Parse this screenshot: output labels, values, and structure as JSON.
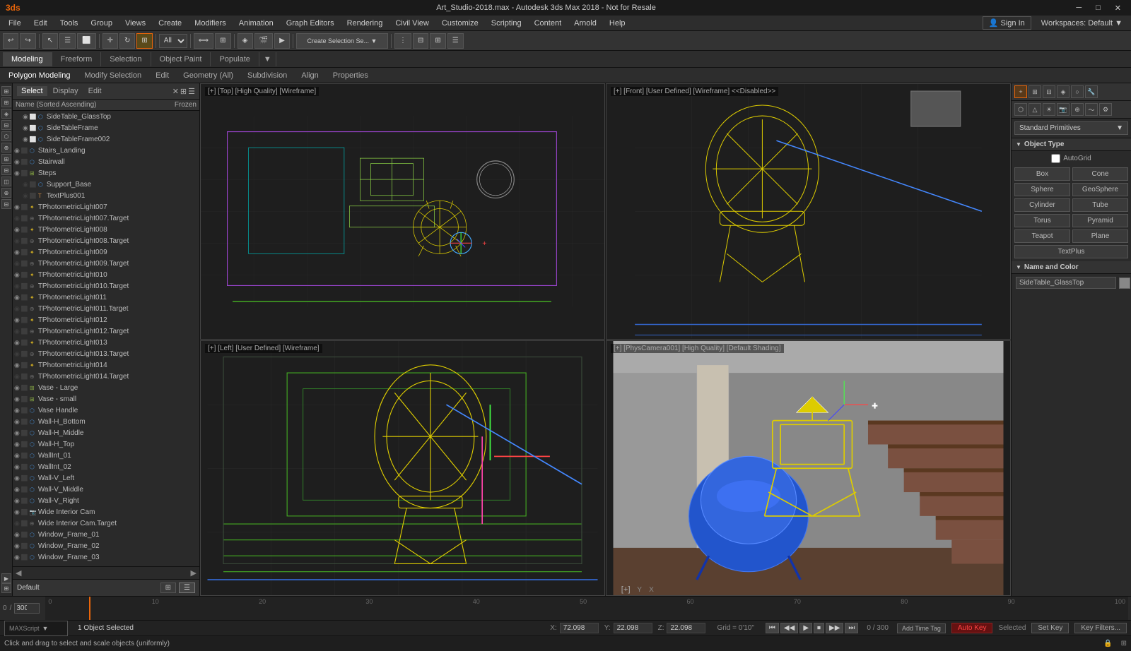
{
  "titlebar": {
    "title": "Art_Studio-2018.max - Autodesk 3ds Max 2018 - Not for Resale",
    "controls": [
      "minimize",
      "maximize",
      "close"
    ]
  },
  "menubar": {
    "items": [
      "File",
      "Edit",
      "Tools",
      "Group",
      "Views",
      "Create",
      "Modifiers",
      "Animation",
      "Graph Editors",
      "Rendering",
      "Civil View",
      "Customize",
      "Scripting",
      "Content",
      "Arnold",
      "Help"
    ]
  },
  "toolbar": {
    "undo_label": "↩",
    "redo_label": "↪",
    "select_region": "All",
    "create_selection": "Create Selection Se...",
    "workspaces_label": "Workspaces: Default",
    "sign_in": "Sign In"
  },
  "tabs": {
    "items": [
      "Modeling",
      "Freeform",
      "Selection",
      "Object Paint",
      "Populate"
    ],
    "active": "Modeling"
  },
  "subtoolbar": {
    "items": [
      "Polygon Modeling",
      "Modify Selection",
      "Edit",
      "Geometry (All)",
      "Subdivision",
      "Align",
      "Properties"
    ]
  },
  "scene_panel": {
    "header_tabs": [
      "Select",
      "Display",
      "Edit"
    ],
    "list_header": {
      "name_label": "Name (Sorted Ascending)",
      "frozen_label": "Frozen"
    },
    "items": [
      {
        "name": "SideTable_GlassTop",
        "indent": 1,
        "selected": false,
        "has_eye": true,
        "has_box": true,
        "type": "mesh"
      },
      {
        "name": "SideTableFrame",
        "indent": 1,
        "selected": false,
        "has_eye": true,
        "has_box": true,
        "type": "mesh"
      },
      {
        "name": "SideTableFrame002",
        "indent": 1,
        "selected": false,
        "has_eye": true,
        "has_box": true,
        "type": "mesh"
      },
      {
        "name": "Stairs_Landing",
        "indent": 0,
        "selected": false,
        "has_eye": true,
        "has_box": false,
        "type": "mesh"
      },
      {
        "name": "Stairwall",
        "indent": 0,
        "selected": false,
        "has_eye": true,
        "has_box": false,
        "type": "mesh"
      },
      {
        "name": "Steps",
        "indent": 0,
        "selected": false,
        "has_eye": true,
        "has_box": false,
        "type": "group"
      },
      {
        "name": "Support_Base",
        "indent": 1,
        "selected": false,
        "has_eye": false,
        "has_box": false,
        "type": "mesh"
      },
      {
        "name": "TextPlus001",
        "indent": 1,
        "selected": false,
        "has_eye": false,
        "has_box": false,
        "type": "text"
      },
      {
        "name": "TPhotometricLight007",
        "indent": 0,
        "selected": false,
        "has_eye": true,
        "has_box": false,
        "type": "light"
      },
      {
        "name": "TPhotometricLight007.Target",
        "indent": 0,
        "selected": false,
        "has_eye": false,
        "has_box": false,
        "type": "target"
      },
      {
        "name": "TPhotometricLight008",
        "indent": 0,
        "selected": false,
        "has_eye": true,
        "has_box": false,
        "type": "light"
      },
      {
        "name": "TPhotometricLight008.Target",
        "indent": 0,
        "selected": false,
        "has_eye": false,
        "has_box": false,
        "type": "target"
      },
      {
        "name": "TPhotometricLight009",
        "indent": 0,
        "selected": false,
        "has_eye": true,
        "has_box": false,
        "type": "light"
      },
      {
        "name": "TPhotometricLight009.Target",
        "indent": 0,
        "selected": false,
        "has_eye": false,
        "has_box": false,
        "type": "target"
      },
      {
        "name": "TPhotometricLight010",
        "indent": 0,
        "selected": false,
        "has_eye": true,
        "has_box": false,
        "type": "light"
      },
      {
        "name": "TPhotometricLight010.Target",
        "indent": 0,
        "selected": false,
        "has_eye": false,
        "has_box": false,
        "type": "target"
      },
      {
        "name": "TPhotometricLight011",
        "indent": 0,
        "selected": false,
        "has_eye": true,
        "has_box": false,
        "type": "light"
      },
      {
        "name": "TPhotometricLight011.Target",
        "indent": 0,
        "selected": false,
        "has_eye": false,
        "has_box": false,
        "type": "target"
      },
      {
        "name": "TPhotometricLight012",
        "indent": 0,
        "selected": false,
        "has_eye": true,
        "has_box": false,
        "type": "light"
      },
      {
        "name": "TPhotometricLight012.Target",
        "indent": 0,
        "selected": false,
        "has_eye": false,
        "has_box": false,
        "type": "target"
      },
      {
        "name": "TPhotometricLight013",
        "indent": 0,
        "selected": false,
        "has_eye": true,
        "has_box": false,
        "type": "light"
      },
      {
        "name": "TPhotometricLight013.Target",
        "indent": 0,
        "selected": false,
        "has_eye": false,
        "has_box": false,
        "type": "target"
      },
      {
        "name": "TPhotometricLight014",
        "indent": 0,
        "selected": false,
        "has_eye": true,
        "has_box": false,
        "type": "light"
      },
      {
        "name": "TPhotometricLight014.Target",
        "indent": 0,
        "selected": false,
        "has_eye": false,
        "has_box": false,
        "type": "target"
      },
      {
        "name": "Vase - Large",
        "indent": 0,
        "selected": false,
        "has_eye": true,
        "has_box": false,
        "type": "group"
      },
      {
        "name": "Vase - small",
        "indent": 0,
        "selected": false,
        "has_eye": true,
        "has_box": false,
        "type": "group"
      },
      {
        "name": "Vase Handle",
        "indent": 0,
        "selected": false,
        "has_eye": true,
        "has_box": false,
        "type": "mesh"
      },
      {
        "name": "Wall-H_Bottom",
        "indent": 0,
        "selected": false,
        "has_eye": true,
        "has_box": false,
        "type": "mesh"
      },
      {
        "name": "Wall-H_Middle",
        "indent": 0,
        "selected": false,
        "has_eye": true,
        "has_box": false,
        "type": "mesh"
      },
      {
        "name": "Wall-H_Top",
        "indent": 0,
        "selected": false,
        "has_eye": true,
        "has_box": false,
        "type": "mesh"
      },
      {
        "name": "WallInt_01",
        "indent": 0,
        "selected": false,
        "has_eye": true,
        "has_box": false,
        "type": "mesh"
      },
      {
        "name": "WallInt_02",
        "indent": 0,
        "selected": false,
        "has_eye": true,
        "has_box": false,
        "type": "mesh"
      },
      {
        "name": "Wall-V_Left",
        "indent": 0,
        "selected": false,
        "has_eye": true,
        "has_box": false,
        "type": "mesh"
      },
      {
        "name": "Wall-V_Middle",
        "indent": 0,
        "selected": false,
        "has_eye": true,
        "has_box": false,
        "type": "mesh"
      },
      {
        "name": "Wall-V_Right",
        "indent": 0,
        "selected": false,
        "has_eye": true,
        "has_box": false,
        "type": "mesh"
      },
      {
        "name": "Wide Interior Cam",
        "indent": 0,
        "selected": false,
        "has_eye": true,
        "has_box": false,
        "type": "camera"
      },
      {
        "name": "Wide Interior Cam.Target",
        "indent": 0,
        "selected": false,
        "has_eye": false,
        "has_box": false,
        "type": "target"
      },
      {
        "name": "Window_Frame_01",
        "indent": 0,
        "selected": false,
        "has_eye": true,
        "has_box": false,
        "type": "mesh"
      },
      {
        "name": "Window_Frame_02",
        "indent": 0,
        "selected": false,
        "has_eye": true,
        "has_box": false,
        "type": "mesh"
      },
      {
        "name": "Window_Frame_03",
        "indent": 0,
        "selected": false,
        "has_eye": true,
        "has_box": false,
        "type": "mesh"
      }
    ],
    "bottom_bar": {
      "label": "Default"
    }
  },
  "viewports": {
    "top_left": {
      "label": "[+] [Top] [High Quality] [Wireframe]",
      "type": "wireframe_top"
    },
    "top_right": {
      "label": "[+] [Front] [User Defined] [Wireframe] <<Disabled>>",
      "type": "wireframe_front"
    },
    "bottom_left": {
      "label": "[+] [Left] [User Defined] [Wireframe]",
      "type": "wireframe_left"
    },
    "bottom_right": {
      "label": "[+] [PhysCamera001] [High Quality] [Default Shading]",
      "type": "rendered"
    }
  },
  "right_panel": {
    "standard_primitives": "Standard Primitives",
    "object_type_label": "Object Type",
    "autogrid_label": "AutoGrid",
    "buttons": [
      "Box",
      "Cone",
      "Sphere",
      "GeoSphere",
      "Cylinder",
      "Tube",
      "Torus",
      "Pyramid",
      "Teapot",
      "Plane",
      "TextPlus"
    ],
    "name_color_section": "Name and Color",
    "selected_name": "SideTable_GlassTop",
    "color_swatch": "#888888"
  },
  "timeline": {
    "start": "0",
    "end": "300",
    "current": "0",
    "markers": [
      "0",
      "10",
      "20",
      "30",
      "40",
      "50",
      "60",
      "70",
      "80",
      "90",
      "100"
    ]
  },
  "bottombar": {
    "selection_status": "1 Object Selected",
    "status_msg": "Click and drag to select and scale objects (uniformly)",
    "x_label": "X:",
    "x_val": "72.098",
    "y_label": "Y:",
    "y_val": "22.098",
    "z_label": "Z:",
    "z_val": "22.098",
    "grid_label": "Grid = 0'10\"",
    "anim_key": "Auto Key",
    "set_key": "Set Key",
    "key_filters": "Key Filters..."
  },
  "icons": {
    "play": "▶",
    "pause": "⏸",
    "stop": "⏹",
    "prev": "⏮",
    "next": "⏭",
    "eye": "👁",
    "lock": "🔒",
    "arrow_right": "▶",
    "arrow_down": "▼",
    "plus": "+",
    "minus": "−",
    "x": "✕",
    "check": "✓"
  }
}
